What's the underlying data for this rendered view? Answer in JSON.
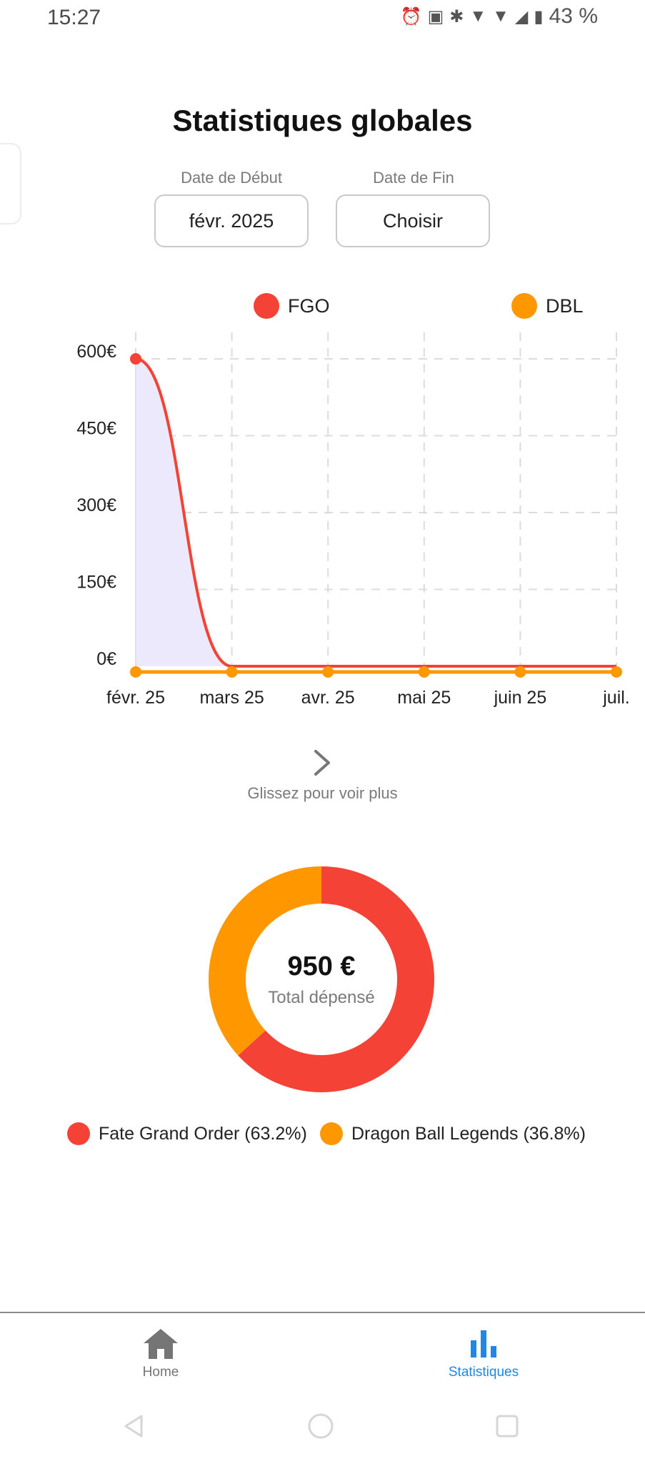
{
  "status_bar": {
    "time": "15:27",
    "battery": "43 %"
  },
  "page": {
    "title": "Statistiques globales"
  },
  "date_range": {
    "start_label": "Date de Début",
    "start_value": "févr. 2025",
    "end_label": "Date de Fin",
    "end_value": "Choisir"
  },
  "chart_data": {
    "type": "area",
    "categories": [
      "févr. 25",
      "mars 25",
      "avr. 25",
      "mai 25",
      "juin 25",
      "juil."
    ],
    "y_ticks": [
      "0€",
      "150€",
      "300€",
      "450€",
      "600€"
    ],
    "ylim": [
      0,
      600
    ],
    "grid": true,
    "legend_placement": "top",
    "series": [
      {
        "name": "FGO",
        "color": "#f44336",
        "values": [
          600,
          0,
          0,
          0,
          0,
          0
        ]
      },
      {
        "name": "DBL",
        "color": "#ff9800",
        "values": [
          0,
          0,
          0,
          0,
          0,
          0
        ]
      }
    ]
  },
  "swipe_hint": "Glissez pour voir plus",
  "donut": {
    "total": "950 €",
    "caption": "Total dépensé",
    "slices": [
      {
        "label": "Fate Grand Order (63.2%)",
        "value": 63.2,
        "color": "#f44336"
      },
      {
        "label": "Dragon Ball Legends (36.8%)",
        "value": 36.8,
        "color": "#ff9800"
      }
    ]
  },
  "bottom_nav": {
    "items": [
      {
        "label": "Home",
        "icon": "home-icon",
        "color": "#757575"
      },
      {
        "label": "Statistiques",
        "icon": "bar-chart-icon",
        "color": "#1e88e5"
      }
    ]
  },
  "colors": {
    "accent": "#1e88e5",
    "fgo": "#f44336",
    "dbl": "#ff9800",
    "area_fill": "#ece9fd"
  }
}
